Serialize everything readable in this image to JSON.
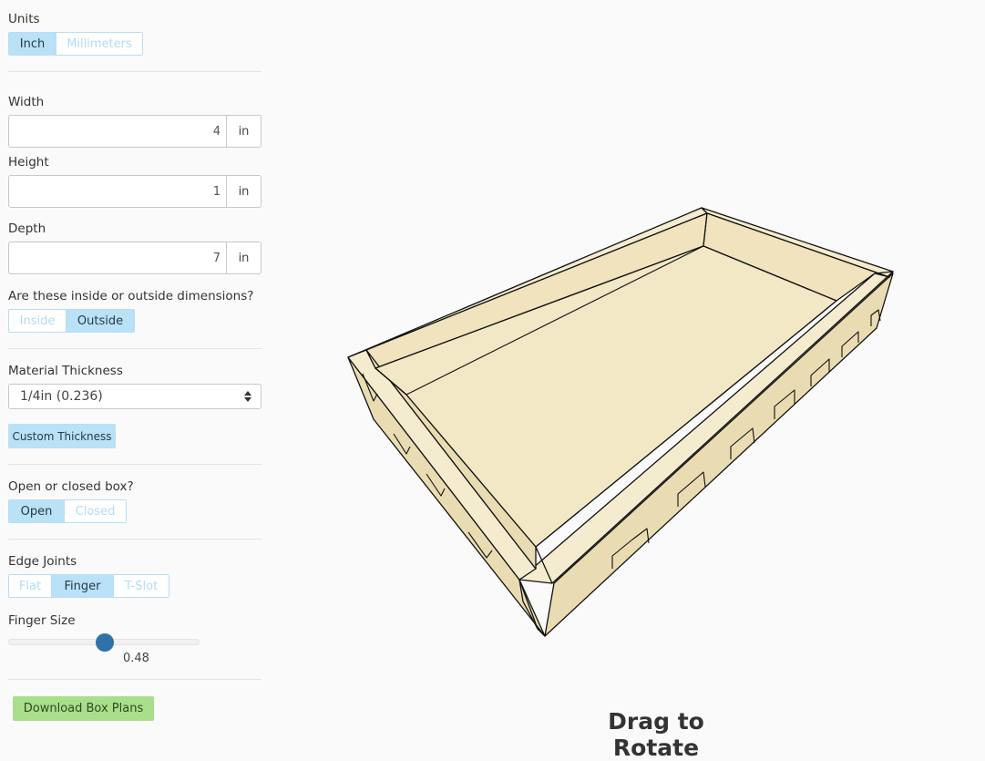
{
  "units": {
    "label": "Units",
    "options": [
      "Inch",
      "Millimeters"
    ],
    "selected": "Inch"
  },
  "dimensions": {
    "width": {
      "label": "Width",
      "value": "4",
      "unit": "in"
    },
    "height": {
      "label": "Height",
      "value": "1",
      "unit": "in"
    },
    "depth": {
      "label": "Depth",
      "value": "7",
      "unit": "in"
    }
  },
  "inside_outside": {
    "label": "Are these inside or outside dimensions?",
    "options": [
      "Inside",
      "Outside"
    ],
    "selected": "Outside"
  },
  "material": {
    "label": "Material Thickness",
    "selected": "1/4in (0.236)",
    "custom_button": "Custom Thickness"
  },
  "open_closed": {
    "label": "Open or closed box?",
    "options": [
      "Open",
      "Closed"
    ],
    "selected": "Open"
  },
  "edge_joints": {
    "label": "Edge Joints",
    "options": [
      "Flat",
      "Finger",
      "T-Slot"
    ],
    "selected": "Finger"
  },
  "finger_size": {
    "label": "Finger Size",
    "value": "0.48",
    "fraction": 0.5
  },
  "download_button": "Download Box Plans",
  "viewport": {
    "drag_label": "Drag to Rotate",
    "box_color": "#f2e8c6",
    "edge_color": "#111111"
  }
}
